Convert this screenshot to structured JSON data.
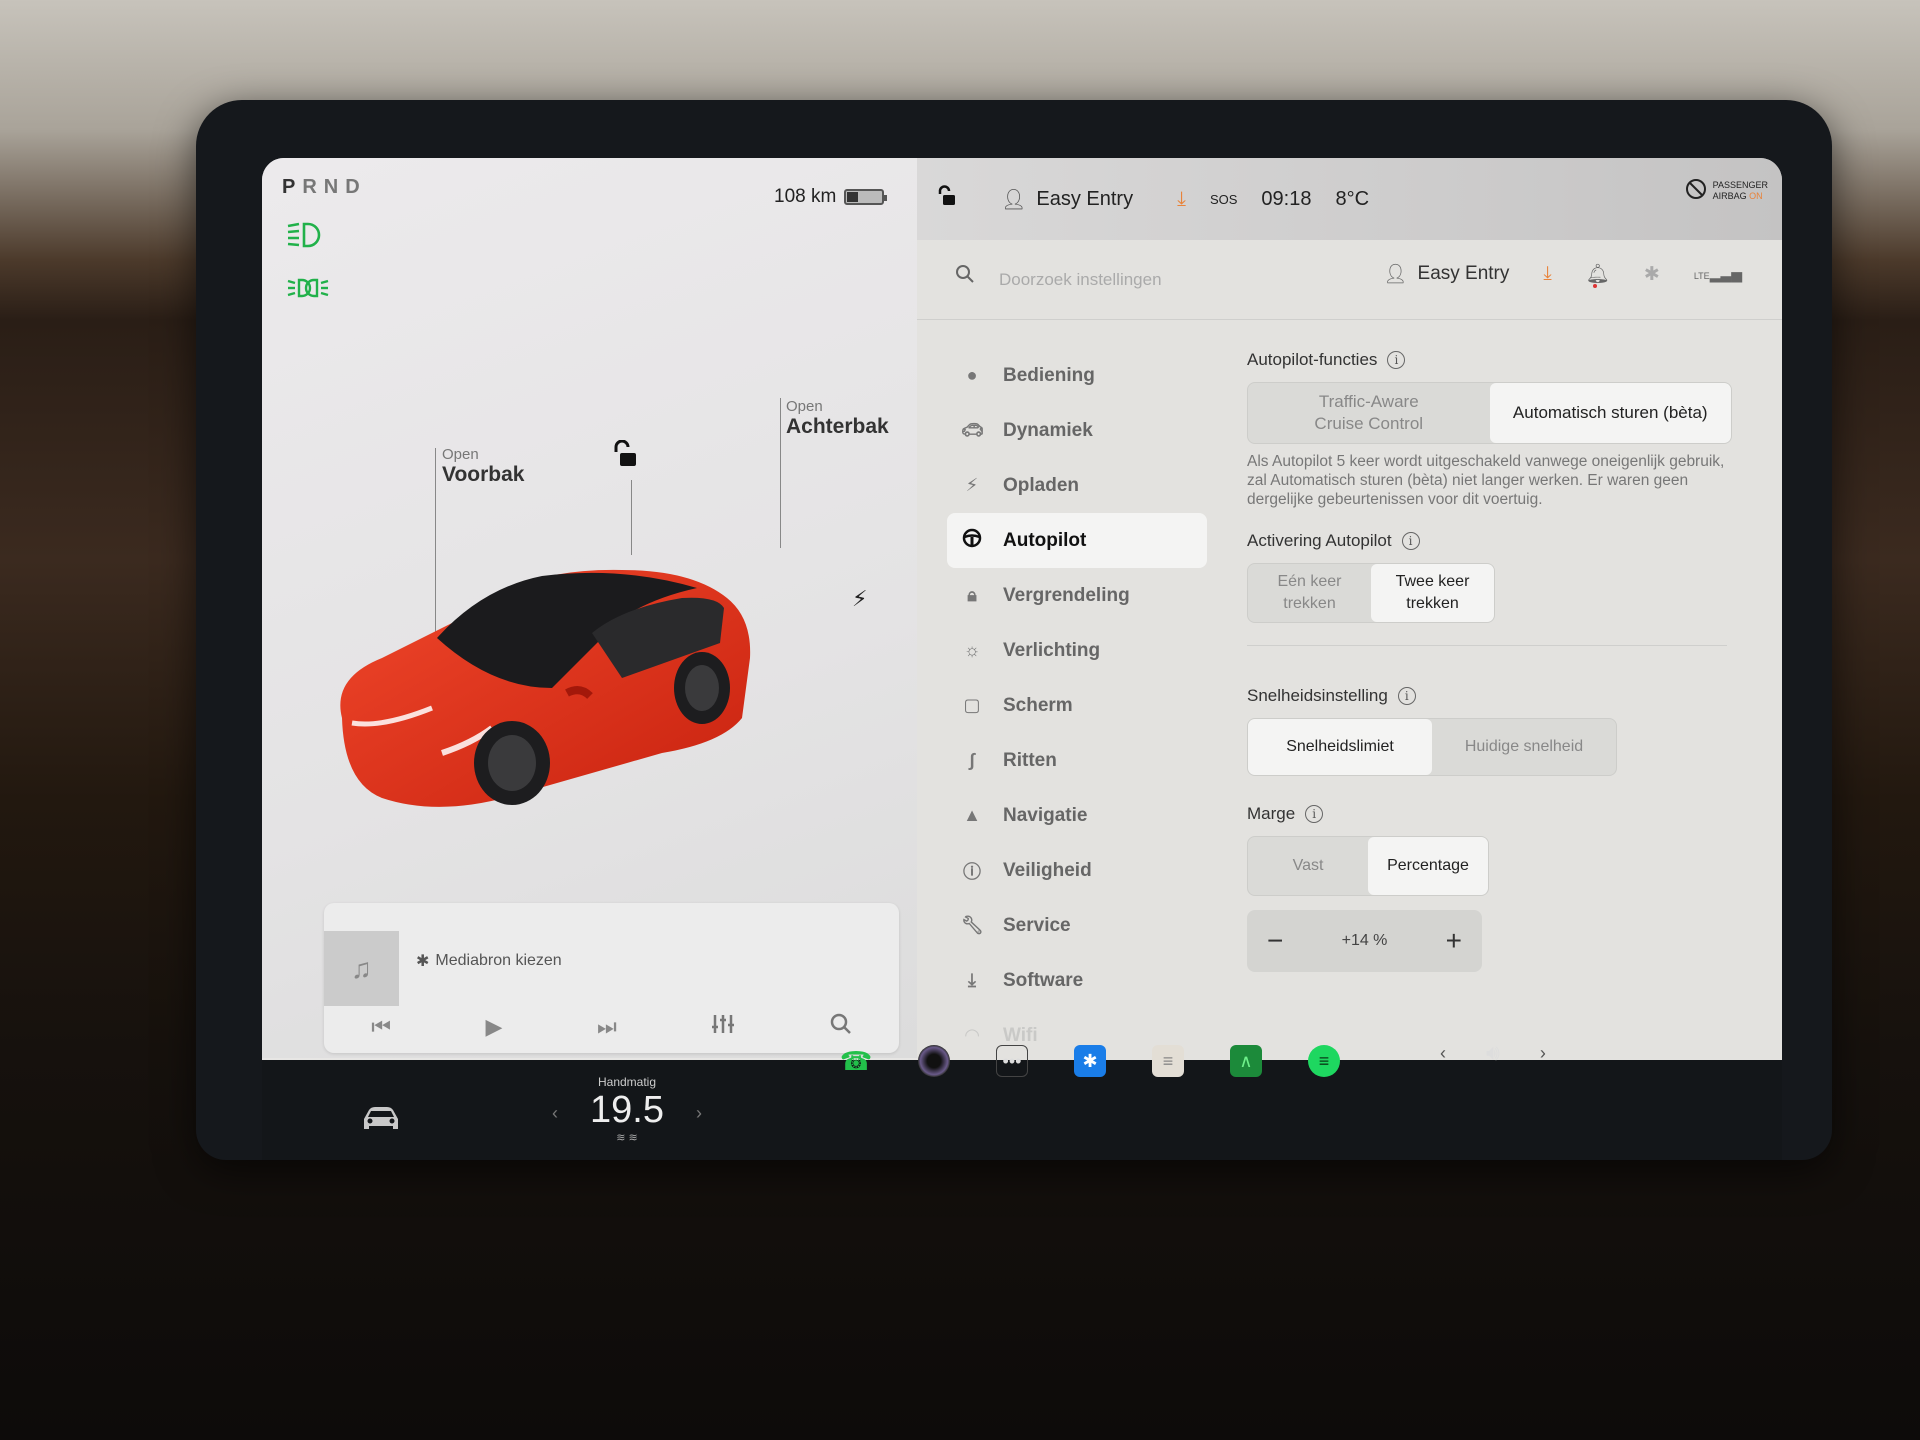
{
  "status": {
    "gear": [
      "P",
      "R",
      "N",
      "D"
    ],
    "active_gear": "P",
    "range": "108 km",
    "battery_level_fraction": 0.3,
    "profile": "Easy Entry",
    "time": "09:18",
    "temperature": "8°C",
    "sos_label": "SOS",
    "airbag": {
      "line1": "PASSENGER",
      "line2_prefix": "AIRBAG",
      "line2_state": "ON"
    },
    "indicator_icons": [
      "headlight-icon",
      "parking-lights-icon"
    ]
  },
  "vehicle": {
    "frunk": {
      "state": "Open",
      "label": "Voorbak"
    },
    "trunk": {
      "state": "Open",
      "label": "Achterbak"
    },
    "lock_state": "unlocked",
    "car_color": "#e8321e"
  },
  "media": {
    "source_label": "Mediabron kiezen",
    "controls": [
      "previous",
      "play",
      "next",
      "equalizer",
      "search"
    ],
    "page_dots": 3,
    "active_dot": 0
  },
  "settings": {
    "search_placeholder": "Doorzoek instellingen",
    "header_profile": "Easy Entry",
    "nav": [
      {
        "label": "Bediening",
        "icon": "toggle-icon"
      },
      {
        "label": "Dynamiek",
        "icon": "car-icon"
      },
      {
        "label": "Opladen",
        "icon": "bolt-icon"
      },
      {
        "label": "Autopilot",
        "icon": "steering-wheel-icon",
        "active": true
      },
      {
        "label": "Vergrendeling",
        "icon": "lock-icon"
      },
      {
        "label": "Verlichting",
        "icon": "light-icon"
      },
      {
        "label": "Scherm",
        "icon": "display-icon"
      },
      {
        "label": "Ritten",
        "icon": "trips-icon"
      },
      {
        "label": "Navigatie",
        "icon": "navigation-icon"
      },
      {
        "label": "Veiligheid",
        "icon": "safety-icon"
      },
      {
        "label": "Service",
        "icon": "wrench-icon"
      },
      {
        "label": "Software",
        "icon": "download-icon"
      },
      {
        "label": "Wifi",
        "icon": "wifi-icon"
      }
    ],
    "autopilot": {
      "features_title": "Autopilot-functies",
      "features_options": [
        "Traffic-Aware\nCruise Control",
        "Automatisch sturen (bèta)"
      ],
      "features_selected": 1,
      "features_description": "Als Autopilot 5 keer wordt uitgeschakeld vanwege oneigenlijk gebruik, zal Automatisch sturen (bèta) niet langer werken. Er waren geen dergelijke gebeurtenissen voor dit voertuig.",
      "activation_title": "Activering Autopilot",
      "activation_options": [
        "Eén keer\ntrekken",
        "Twee keer\ntrekken"
      ],
      "activation_selected": 1,
      "speed_title": "Snelheidsinstelling",
      "speed_options": [
        "Snelheidslimiet",
        "Huidige snelheid"
      ],
      "speed_selected": 0,
      "margin_title": "Marge",
      "margin_options": [
        "Vast",
        "Percentage"
      ],
      "margin_selected": 1,
      "margin_value": "+14 %",
      "minus": "−",
      "plus": "+"
    }
  },
  "climate": {
    "mode": "Handmatig",
    "temp": "19.5"
  },
  "dock": {
    "apps": [
      "phone",
      "camera",
      "more",
      "bluetooth",
      "toybox",
      "energy",
      "spotify"
    ],
    "colors": {
      "phone": "#22c04a",
      "bluetooth": "#1a7de8",
      "spotify": "#1ed760",
      "energy": "#1c8a3a",
      "accent_orange": "#e8833a",
      "indicator_green": "#21b14a"
    }
  }
}
